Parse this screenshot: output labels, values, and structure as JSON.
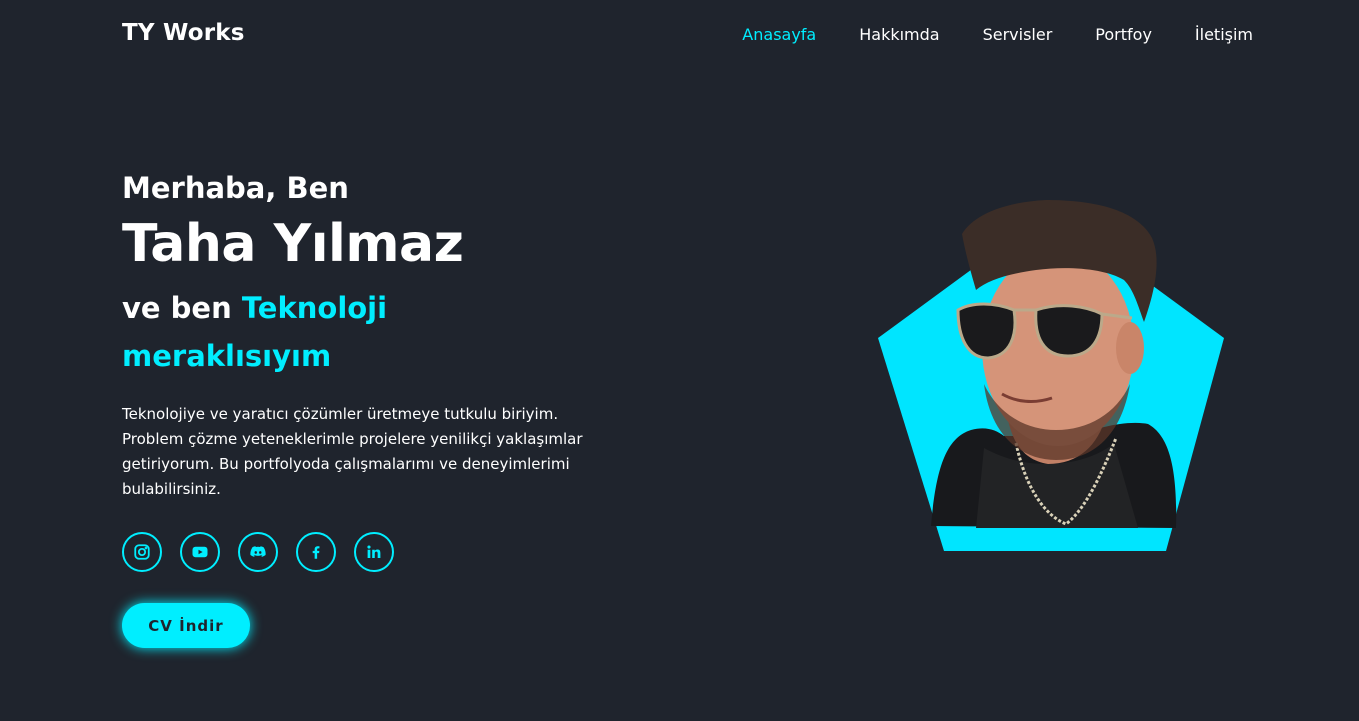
{
  "header": {
    "logo": "TY Works",
    "nav": [
      "Anasayfa",
      "Hakkımda",
      "Servisler",
      "Portfoy",
      "İletişim"
    ],
    "active_index": 0
  },
  "home": {
    "greeting": "Merhaba, Ben",
    "name": "Taha Yılmaz",
    "role_prefix": "ve ben",
    "role_accent": "Teknoloji meraklısıyım",
    "description": "Teknolojiye ve yaratıcı çözümler üretmeye tutkulu biriyim. Problem çözme yeteneklerimle projelere yenilikçi yaklaşımlar getiriyorum. Bu portfolyoda çalışmalarımı ve deneyimlerimi bulabilirsiniz.",
    "social_icons": [
      "instagram-icon",
      "youtube-icon",
      "discord-icon",
      "facebook-icon",
      "linkedin-icon"
    ],
    "cv_button": "CV İndir"
  },
  "colors": {
    "background": "#1f242d",
    "accent": "#00eeff",
    "text": "#ffffff"
  }
}
